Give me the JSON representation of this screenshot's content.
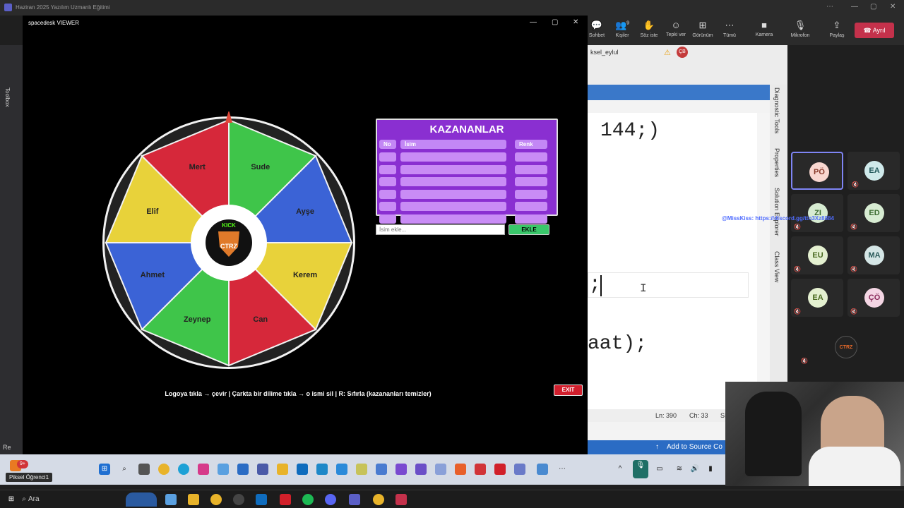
{
  "teams": {
    "window_title": "Haziran 2025 Yazılım Uzmanlı Eğitimi",
    "toolbar": [
      {
        "label": "Sohbet",
        "icon": "chat-icon"
      },
      {
        "label": "Kişiler",
        "icon": "people-icon",
        "count": "9"
      },
      {
        "label": "Söz iste",
        "icon": "raise-hand-icon"
      },
      {
        "label": "Tepki ver",
        "icon": "reaction-icon"
      },
      {
        "label": "Görünüm",
        "icon": "view-icon"
      },
      {
        "label": "Tümü",
        "icon": "more-icon"
      },
      {
        "label": "Kamera",
        "icon": "camera-icon"
      },
      {
        "label": "Mikrofon",
        "icon": "microphone-icon"
      },
      {
        "label": "Paylaş",
        "icon": "share-icon"
      }
    ],
    "leave_label": "Ayrıl",
    "participants": [
      {
        "initials": "PÖ",
        "bg": "#f9d7d0",
        "fg": "#8a3b2b",
        "selected": true
      },
      {
        "initials": "EA",
        "bg": "#cfe9ea",
        "fg": "#22585b"
      },
      {
        "initials": "ZI",
        "bg": "#d7ecd2",
        "fg": "#3b6b30"
      },
      {
        "initials": "ED",
        "bg": "#d7ecd2",
        "fg": "#3b6b30"
      },
      {
        "initials": "EU",
        "bg": "#e4f0d0",
        "fg": "#4a6a20"
      },
      {
        "initials": "MA",
        "bg": "#d5e6e6",
        "fg": "#2b5b5b"
      },
      {
        "initials": "EA",
        "bg": "#e4f0d0",
        "fg": "#4a6a20"
      },
      {
        "initials": "ÇÖ",
        "bg": "#f4d6e4",
        "fg": "#8a2b5b"
      }
    ],
    "overlay_text": "@MissKiss: https://discord.gg/ttn3Xz8884"
  },
  "vs": {
    "tab": "ksel_eylul",
    "code_lines": [
      "144;)",
      ";",
      "aat);"
    ],
    "status": {
      "ln": "Ln: 390",
      "ch": "Ch: 33",
      "extra": "SI"
    },
    "add_to_source": "Add to Source Co",
    "side_tabs": [
      "Diagnostic Tools",
      "Properties",
      "Solution Explorer",
      "Class View"
    ],
    "left_tab": "Toolbox",
    "left_bottom": "Re"
  },
  "spacedesk": {
    "title": "spacedesk VIEWER"
  },
  "wheel": {
    "segments": [
      {
        "name": "Sude",
        "color": "#3fc54a"
      },
      {
        "name": "Ayşe",
        "color": "#3b63d6"
      },
      {
        "name": "Kerem",
        "color": "#e8d23a"
      },
      {
        "name": "Can",
        "color": "#d6283a"
      },
      {
        "name": "Zeynep",
        "color": "#3fc54a"
      },
      {
        "name": "Ahmet",
        "color": "#3b63d6"
      },
      {
        "name": "Elif",
        "color": "#e8d23a"
      },
      {
        "name": "Mert",
        "color": "#d6283a"
      }
    ],
    "logo_top": "KICK",
    "logo_text": "CTRZ",
    "pointer_color": "#e0483a"
  },
  "winners": {
    "title": "KAZANANLAR",
    "headers": [
      "No",
      "İsim",
      "Renk"
    ],
    "row_count": 6
  },
  "form": {
    "placeholder": "İsim ekle...",
    "add_label": "EKLE"
  },
  "hint": "Logoya tıkla → çevir | Çarkta bir dilime tıkla → o ismi sil | R: Sıfırla (kazananları temizler)",
  "exit_label": "EXIT",
  "inner_taskbar": {
    "student_label": "Piksel Öğrenci1",
    "badge": "9+"
  },
  "outer_taskbar": {
    "search": "Ara"
  }
}
